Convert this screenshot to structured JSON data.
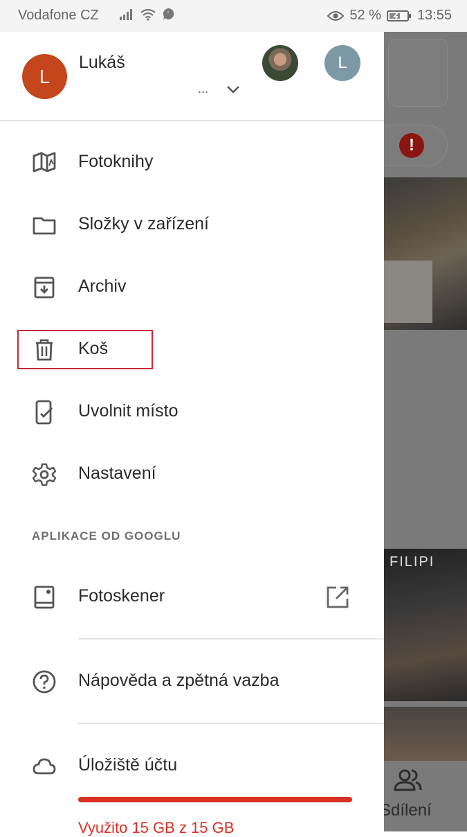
{
  "status_bar": {
    "carrier": "Vodafone CZ",
    "battery": "52 %",
    "time": "13:55"
  },
  "account": {
    "name": "Lukáš",
    "email": "...",
    "avatar_letter": "L",
    "alt_avatar_letter": "L"
  },
  "menu": {
    "items": [
      {
        "label": "Fotoknihy",
        "icon": "photobook-icon"
      },
      {
        "label": "Složky v zařízení",
        "icon": "folder-icon"
      },
      {
        "label": "Archiv",
        "icon": "archive-icon"
      },
      {
        "label": "Koš",
        "icon": "trash-icon"
      },
      {
        "label": "Uvolnit místo",
        "icon": "phone-check-icon"
      },
      {
        "label": "Nastavení",
        "icon": "gear-icon"
      }
    ],
    "section_header": "APLIKACE OD GOOGLU",
    "google_apps": [
      {
        "label": "Fotoskener",
        "icon": "photoscan-icon"
      }
    ],
    "help": {
      "label": "Nápověda a zpětná vazba",
      "icon": "help-icon"
    },
    "storage": {
      "label": "Úložiště účtu",
      "icon": "cloud-icon",
      "usage_text": "Využito 15 GB z 15 GB",
      "used_fraction": 1.0
    }
  },
  "background_app": {
    "share_label": "Sdílení",
    "photo_caption": "FILIPI"
  },
  "colors": {
    "highlight": "#c9273a",
    "storage": "#d93025",
    "avatar": "#c5451d"
  }
}
